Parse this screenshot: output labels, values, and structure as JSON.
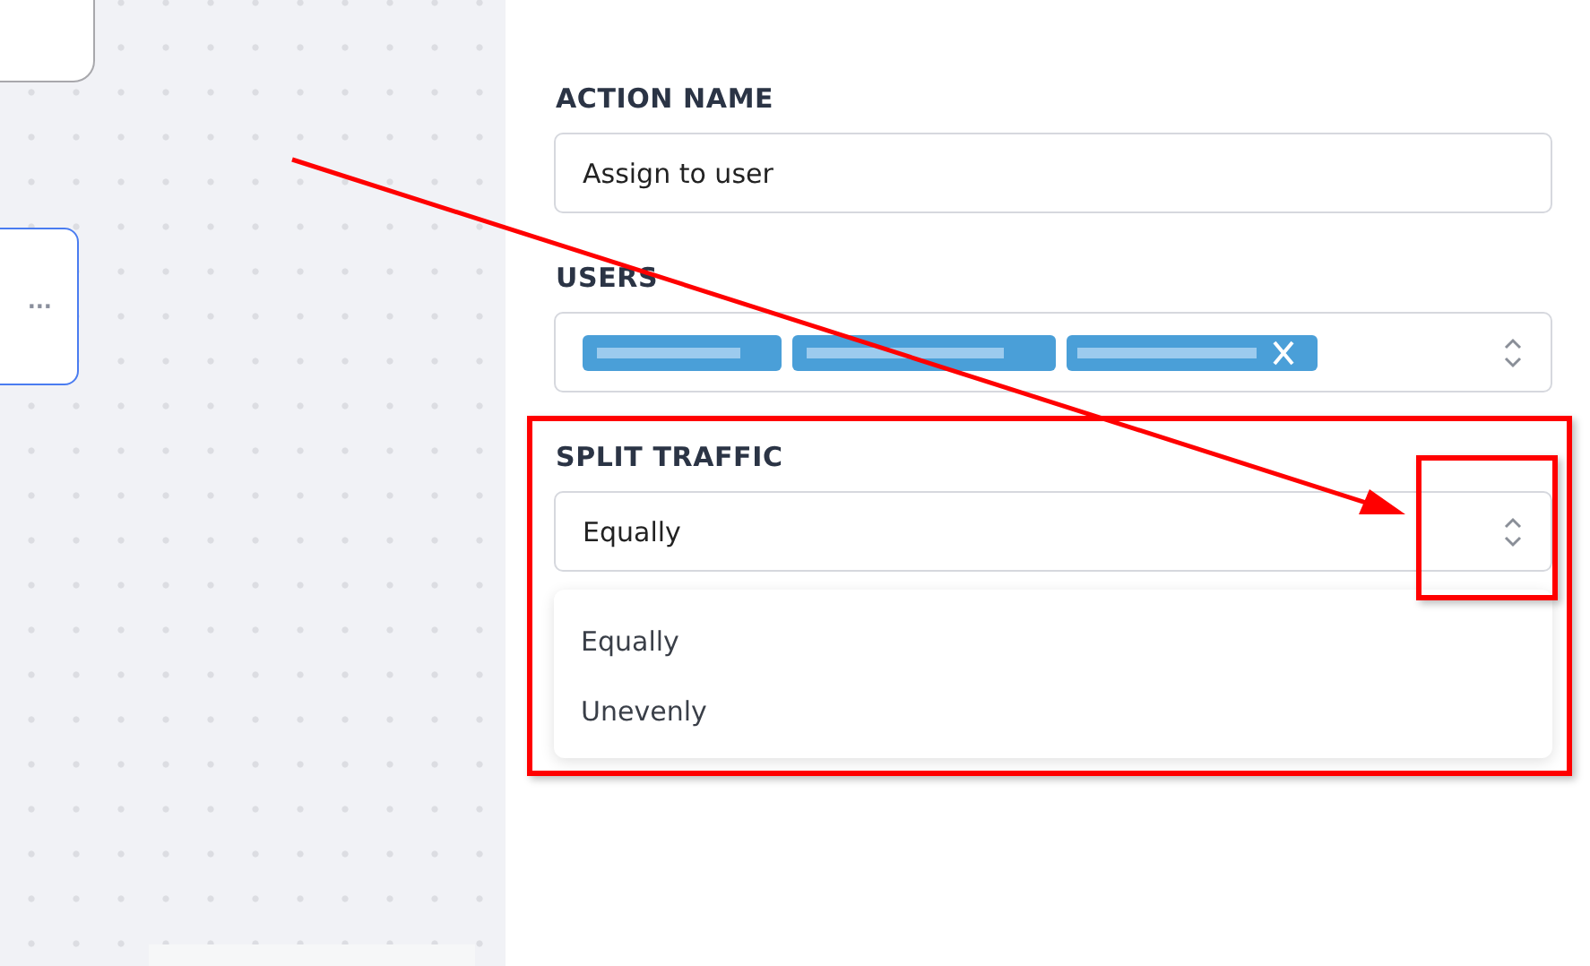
{
  "canvas": {
    "node_menu": "···"
  },
  "action_name": {
    "label": "ACTION NAME",
    "value": "Assign to user"
  },
  "users": {
    "label": "USERS"
  },
  "split_traffic": {
    "label": "SPLIT TRAFFIC",
    "value": "Equally",
    "expanded": true,
    "options": [
      {
        "label": "Equally"
      },
      {
        "label": "Unevenly"
      }
    ]
  }
}
